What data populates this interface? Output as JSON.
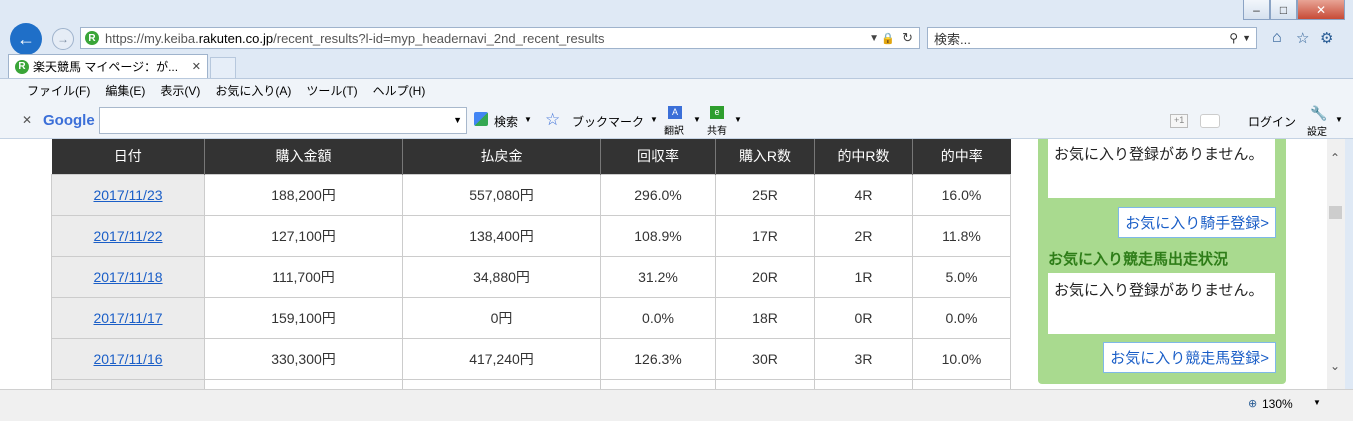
{
  "window": {
    "min": "–",
    "max": "□",
    "close": "✕"
  },
  "address": {
    "prefix": "https://my.keiba.",
    "domain": "rakuten.co.jp",
    "path": "/recent_results?l-id=myp_headernavi_2nd_recent_results"
  },
  "search": {
    "placeholder": "検索..."
  },
  "tab": {
    "title": "楽天競馬 マイページ：が...",
    "favicon": "R"
  },
  "menu": [
    "ファイル(F)",
    "編集(E)",
    "表示(V)",
    "お気に入り(A)",
    "ツール(T)",
    "ヘルプ(H)"
  ],
  "google_toolbar": {
    "logo": "Google",
    "search_label": "検索",
    "bookmark_label": "ブックマーク",
    "translate_label": "翻訳",
    "share_label": "共有",
    "login_label": "ログイン",
    "settings_label": "設定",
    "plus_label": "+1"
  },
  "table": {
    "headers": [
      "日付",
      "購入金額",
      "払戻金",
      "回収率",
      "購入R数",
      "的中R数",
      "的中率"
    ],
    "rows": [
      {
        "date": "2017/11/23",
        "purchase": "188,200円",
        "payout": "557,080円",
        "recovery": "296.0%",
        "bought": "25R",
        "hits": "4R",
        "hit_rate": "16.0%"
      },
      {
        "date": "2017/11/22",
        "purchase": "127,100円",
        "payout": "138,400円",
        "recovery": "108.9%",
        "bought": "17R",
        "hits": "2R",
        "hit_rate": "11.8%"
      },
      {
        "date": "2017/11/18",
        "purchase": "111,700円",
        "payout": "34,880円",
        "recovery": "31.2%",
        "bought": "20R",
        "hits": "1R",
        "hit_rate": "5.0%"
      },
      {
        "date": "2017/11/17",
        "purchase": "159,100円",
        "payout": "0円",
        "recovery": "0.0%",
        "bought": "18R",
        "hits": "0R",
        "hit_rate": "0.0%"
      },
      {
        "date": "2017/11/16",
        "purchase": "330,300円",
        "payout": "417,240円",
        "recovery": "126.3%",
        "bought": "30R",
        "hits": "3R",
        "hit_rate": "10.0%"
      }
    ]
  },
  "sidebar": {
    "jockey_empty": "お気に入り登録がありません。",
    "jockey_button": "お気に入り騎手登録>",
    "horse_heading": "お気に入り競走馬出走状況",
    "horse_empty": "お気に入り登録がありません。",
    "horse_button": "お気に入り競走馬登録>"
  },
  "status": {
    "zoom": "130%"
  }
}
